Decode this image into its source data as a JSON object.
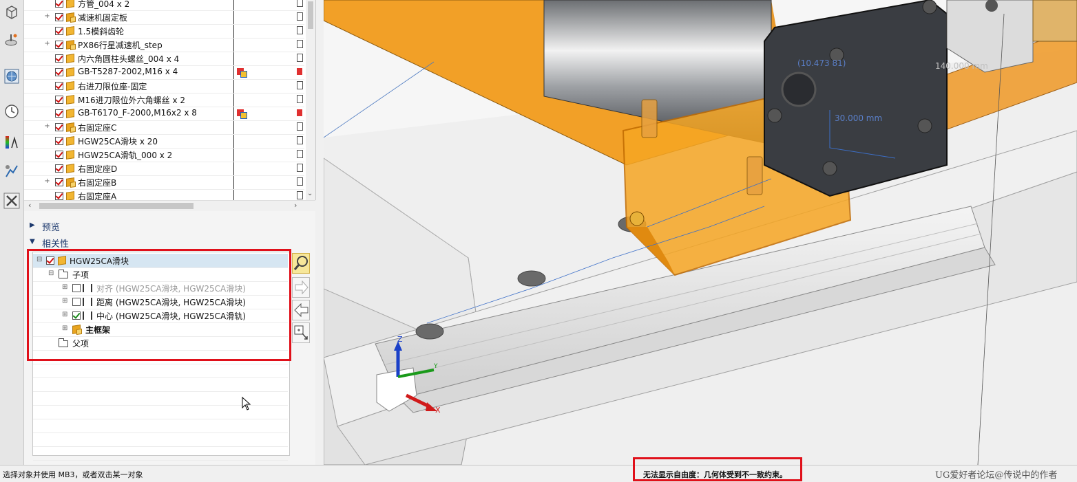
{
  "assembly_tree": {
    "rows": [
      {
        "label": "方管_004 x 2",
        "expandable": false,
        "icon": "part-icon",
        "extra": false
      },
      {
        "label": "减速机固定板",
        "expandable": true,
        "icon": "assembly-icon",
        "extra": false
      },
      {
        "label": "1.5模斜齿轮",
        "expandable": false,
        "icon": "part-icon",
        "extra": false
      },
      {
        "label": "PX86行星减速机_step",
        "expandable": true,
        "icon": "assembly-icon",
        "extra": false
      },
      {
        "label": "内六角圆柱头螺丝_004 x 4",
        "expandable": false,
        "icon": "part-icon",
        "extra": false
      },
      {
        "label": "GB-T5287-2002,M16 x 4",
        "expandable": false,
        "icon": "part-icon",
        "extra": true
      },
      {
        "label": "右进刀限位座-固定",
        "expandable": false,
        "icon": "part-icon",
        "extra": false
      },
      {
        "label": "M16进刀限位外六角螺丝 x 2",
        "expandable": false,
        "icon": "part-icon",
        "extra": false
      },
      {
        "label": "GB-T6170_F-2000,M16x2 x 8",
        "expandable": false,
        "icon": "part-icon",
        "extra": true
      },
      {
        "label": "右固定座C",
        "expandable": true,
        "icon": "assembly-icon",
        "extra": false
      },
      {
        "label": "HGW25CA滑块 x 20",
        "expandable": false,
        "icon": "part-icon",
        "extra": false
      },
      {
        "label": "HGW25CA滑轨_000 x 2",
        "expandable": false,
        "icon": "part-icon",
        "extra": false
      },
      {
        "label": "右固定座D",
        "expandable": false,
        "icon": "part-icon",
        "extra": false
      },
      {
        "label": "右固定座B",
        "expandable": true,
        "icon": "assembly-icon",
        "extra": false
      },
      {
        "label": "右固定座A",
        "expandable": false,
        "icon": "part-icon",
        "extra": false
      }
    ]
  },
  "sections": {
    "preview": "预览",
    "dependencies": "相关性"
  },
  "dependencies": {
    "root": "HGW25CA滑块",
    "children_folder": "子项",
    "constraints": [
      {
        "label": "对齐 (HGW25CA滑块, HGW25CA滑块)",
        "checked": false,
        "dimmed": true,
        "icon": "align-constraint-icon"
      },
      {
        "label": "距离 (HGW25CA滑块, HGW25CA滑块)",
        "checked": false,
        "dimmed": false,
        "icon": "distance-constraint-icon"
      },
      {
        "label": "中心 (HGW25CA滑块, HGW25CA滑轨)",
        "checked": true,
        "dimmed": false,
        "icon": "center-constraint-icon"
      }
    ],
    "main_frame": "主框架",
    "parents_folder": "父项"
  },
  "viewport": {
    "dim1": "(10.473 81)",
    "dim2": "30.000 mm",
    "dim3": "140.000 mm",
    "axis_z": "Z",
    "axis_x": "X",
    "axis_y": "Y",
    "body_color": "#3a3d42",
    "highlight_color": "#f2a027"
  },
  "status": {
    "prompt": "选择对象并使用 MB3，或者双击某一对象",
    "message": "无法显示自由度：几何体受到不一致约束。",
    "watermark": "UG爱好者论坛@传说中的作者"
  }
}
